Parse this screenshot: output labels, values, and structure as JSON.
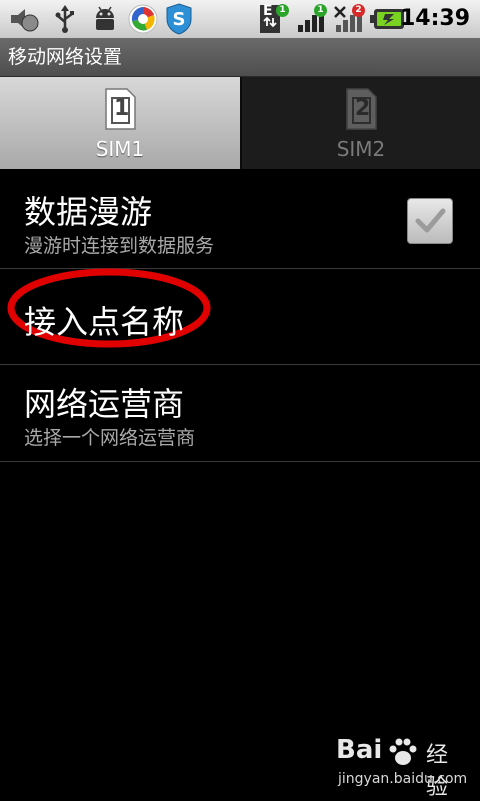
{
  "status_bar": {
    "time": "14:39",
    "icons": [
      "volume-icon",
      "usb-icon",
      "android-debug-icon",
      "browser-icon",
      "shield-s-icon",
      "data-e-icon",
      "signal-icon",
      "signal-x-icon",
      "battery-icon"
    ],
    "badges": {
      "sim1": "1",
      "sim2": "1",
      "sim3": "2"
    },
    "network_type": "E"
  },
  "title": "移动网络设置",
  "tabs": [
    {
      "label": "SIM1",
      "number": "1",
      "active": true
    },
    {
      "label": "SIM2",
      "number": "2",
      "active": false
    }
  ],
  "settings": {
    "data_roaming": {
      "title": "数据漫游",
      "summary": "漫游时连接到数据服务",
      "checked": true
    },
    "apn": {
      "title": "接入点名称"
    },
    "operator": {
      "title": "网络运营商",
      "summary": "选择一个网络运营商"
    }
  },
  "watermark": {
    "brand": "Bai",
    "cn": "经验",
    "url": "jingyan.baidu.com"
  },
  "colors": {
    "highlight_ellipse": "#e00000",
    "badge_green": "#2aa52a",
    "badge_red": "#d62a2a"
  }
}
